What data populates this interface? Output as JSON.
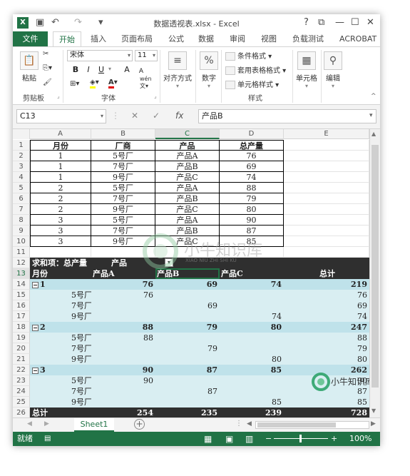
{
  "window": {
    "title": "数据透视表.xlsx - Excel",
    "help": "?",
    "restore": "⧉",
    "minimize": "—",
    "maximize": "☐",
    "close": "✕"
  },
  "qat": {
    "save_icon": "save-icon",
    "undo_icon": "undo-icon",
    "redo_icon": "redo-icon"
  },
  "tabs": {
    "file": "文件",
    "items": [
      "开始",
      "插入",
      "页面布局",
      "公式",
      "数据",
      "审阅",
      "视图",
      "负载测试",
      "ACROBAT"
    ]
  },
  "ribbon": {
    "clipboard": {
      "paste": "粘贴",
      "label": "剪贴板"
    },
    "font": {
      "name": "宋体",
      "size": "11",
      "bold": "B",
      "italic": "I",
      "underline": "U",
      "grow": "A",
      "shrink": "A",
      "label": "字体",
      "wen": "wén"
    },
    "alignment": {
      "label": "对齐方式"
    },
    "number": {
      "label": "数字",
      "symbol": "%"
    },
    "styles": {
      "conditional": "条件格式",
      "table": "套用表格格式",
      "cell": "单元格样式",
      "label": "样式"
    },
    "cells": {
      "label": "单元格"
    },
    "editing": {
      "label": "编辑"
    }
  },
  "formula_bar": {
    "name_box": "C13",
    "formula": "产品B",
    "cancel": "✕",
    "enter": "✓",
    "fx": "fx"
  },
  "columns": [
    "A",
    "B",
    "C",
    "D",
    "E"
  ],
  "source_table": {
    "headers": [
      "月份",
      "厂商",
      "产品",
      "总产量"
    ],
    "rows": [
      [
        "1",
        "5号厂",
        "产品A",
        "76"
      ],
      [
        "1",
        "7号厂",
        "产品B",
        "69"
      ],
      [
        "1",
        "9号厂",
        "产品C",
        "74"
      ],
      [
        "2",
        "5号厂",
        "产品A",
        "88"
      ],
      [
        "2",
        "7号厂",
        "产品B",
        "79"
      ],
      [
        "2",
        "9号厂",
        "产品C",
        "80"
      ],
      [
        "3",
        "5号厂",
        "产品A",
        "90"
      ],
      [
        "3",
        "7号厂",
        "产品B",
        "87"
      ],
      [
        "3",
        "9号厂",
        "产品C",
        "85"
      ]
    ]
  },
  "pivot": {
    "value_field": "求和项：总产量",
    "column_field": "产品",
    "row_field": "月份",
    "col_headers": [
      "产品A",
      "产品B",
      "产品C",
      "总计"
    ],
    "groups": [
      {
        "month": "1",
        "subtotal": [
          "76",
          "69",
          "74",
          "219"
        ],
        "rows": [
          {
            "factory": "5号厂",
            "vals": [
              "76",
              "",
              "",
              "76"
            ]
          },
          {
            "factory": "7号厂",
            "vals": [
              "",
              "69",
              "",
              "69"
            ]
          },
          {
            "factory": "9号厂",
            "vals": [
              "",
              "",
              "74",
              "74"
            ]
          }
        ]
      },
      {
        "month": "2",
        "subtotal": [
          "88",
          "79",
          "80",
          "247"
        ],
        "rows": [
          {
            "factory": "5号厂",
            "vals": [
              "88",
              "",
              "",
              "88"
            ]
          },
          {
            "factory": "7号厂",
            "vals": [
              "",
              "79",
              "",
              "79"
            ]
          },
          {
            "factory": "9号厂",
            "vals": [
              "",
              "",
              "80",
              "80"
            ]
          }
        ]
      },
      {
        "month": "3",
        "subtotal": [
          "90",
          "87",
          "85",
          "262"
        ],
        "rows": [
          {
            "factory": "5号厂",
            "vals": [
              "90",
              "",
              "",
              "90"
            ]
          },
          {
            "factory": "7号厂",
            "vals": [
              "",
              "87",
              "",
              "87"
            ]
          },
          {
            "factory": "9号厂",
            "vals": [
              "",
              "",
              "85",
              "85"
            ]
          }
        ]
      }
    ],
    "grand_total_label": "总计",
    "grand_total": [
      "254",
      "235",
      "239",
      "728"
    ]
  },
  "watermark": {
    "text": "小牛知识库",
    "sub": "XIAO NIU ZHI SHI KU"
  },
  "sheet_tab": "Sheet1",
  "status": {
    "ready": "就绪",
    "zoom": "100%"
  }
}
